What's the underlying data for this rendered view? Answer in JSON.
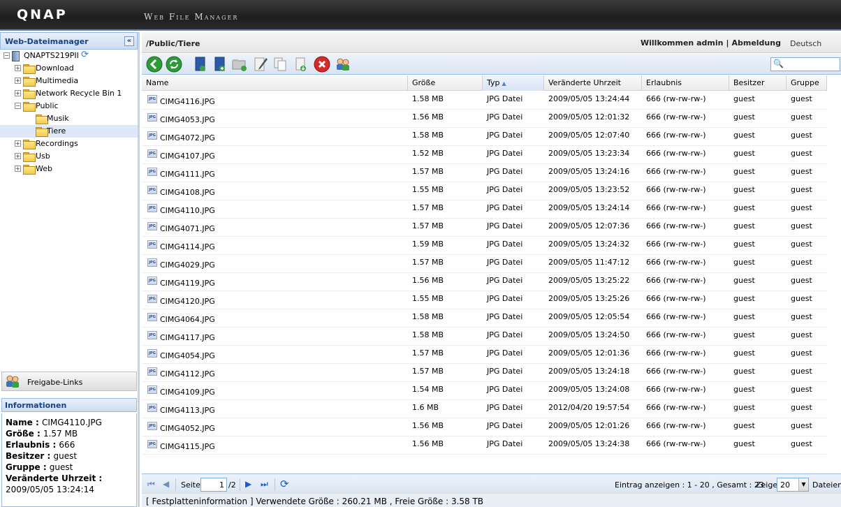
{
  "banner": {
    "logo": "QNAP",
    "product": "Web File Manager"
  },
  "sidebar": {
    "title": "Web-Dateimanager",
    "collapse_glyph": "«",
    "root": "QNAPTS219PII",
    "tree": [
      {
        "label": "Download",
        "depth": 1,
        "expanded": false
      },
      {
        "label": "Multimedia",
        "depth": 1,
        "expanded": false
      },
      {
        "label": "Network Recycle Bin 1",
        "depth": 1,
        "expanded": false
      },
      {
        "label": "Public",
        "depth": 1,
        "expanded": true
      },
      {
        "label": "Musik",
        "depth": 2,
        "expanded": false
      },
      {
        "label": "Tiere",
        "depth": 2,
        "expanded": false,
        "selected": true
      },
      {
        "label": "Recordings",
        "depth": 1,
        "expanded": false
      },
      {
        "label": "Usb",
        "depth": 1,
        "expanded": false
      },
      {
        "label": "Web",
        "depth": 1,
        "expanded": false
      }
    ],
    "share_links": "Freigabe-Links",
    "info_title": "Informationen",
    "info": {
      "name_label": "Name",
      "name": "CIMG4110.JPG",
      "size_label": "Größe",
      "size": "1.57 MB",
      "perm_label": "Erlaubnis",
      "perm": "666",
      "owner_label": "Besitzer",
      "owner": "guest",
      "group_label": "Gruppe",
      "group": "guest",
      "modified_label": "Veränderte Uhrzeit",
      "modified": "2009/05/05 13:24:14"
    }
  },
  "header": {
    "path": "/Public/Tiere",
    "welcome": "Willkommen admin",
    "separator": "|",
    "logout": "Abmeldung",
    "language": "Deutsch"
  },
  "toolbar": {
    "icons": [
      "back-icon",
      "refresh-icon",
      "new-share-icon",
      "upload-icon",
      "new-folder-icon",
      "rename-icon",
      "copy-icon",
      "download-icon",
      "delete-icon",
      "share-link-icon"
    ],
    "search_glyph": "🔍"
  },
  "grid": {
    "columns": [
      "Name",
      "Größe",
      "Typ",
      "Veränderte Uhrzeit",
      "Erlaubnis",
      "Besitzer",
      "Gruppe"
    ],
    "sort_glyph": "▲",
    "file_badge": "JPG",
    "rows": [
      [
        "CIMG4116.JPG",
        "1.58 MB",
        "JPG Datei",
        "2009/05/05 13:24:44",
        "666 (rw-rw-rw-)",
        "guest",
        "guest"
      ],
      [
        "CIMG4053.JPG",
        "1.56 MB",
        "JPG Datei",
        "2009/05/05 12:01:32",
        "666 (rw-rw-rw-)",
        "guest",
        "guest"
      ],
      [
        "CIMG4072.JPG",
        "1.58 MB",
        "JPG Datei",
        "2009/05/05 12:07:40",
        "666 (rw-rw-rw-)",
        "guest",
        "guest"
      ],
      [
        "CIMG4107.JPG",
        "1.52 MB",
        "JPG Datei",
        "2009/05/05 13:23:34",
        "666 (rw-rw-rw-)",
        "guest",
        "guest"
      ],
      [
        "CIMG4111.JPG",
        "1.57 MB",
        "JPG Datei",
        "2009/05/05 13:24:16",
        "666 (rw-rw-rw-)",
        "guest",
        "guest"
      ],
      [
        "CIMG4108.JPG",
        "1.55 MB",
        "JPG Datei",
        "2009/05/05 13:23:52",
        "666 (rw-rw-rw-)",
        "guest",
        "guest"
      ],
      [
        "CIMG4110.JPG",
        "1.57 MB",
        "JPG Datei",
        "2009/05/05 13:24:14",
        "666 (rw-rw-rw-)",
        "guest",
        "guest"
      ],
      [
        "CIMG4071.JPG",
        "1.57 MB",
        "JPG Datei",
        "2009/05/05 12:07:36",
        "666 (rw-rw-rw-)",
        "guest",
        "guest"
      ],
      [
        "CIMG4114.JPG",
        "1.59 MB",
        "JPG Datei",
        "2009/05/05 13:24:32",
        "666 (rw-rw-rw-)",
        "guest",
        "guest"
      ],
      [
        "CIMG4029.JPG",
        "1.57 MB",
        "JPG Datei",
        "2009/05/05 11:47:12",
        "666 (rw-rw-rw-)",
        "guest",
        "guest"
      ],
      [
        "CIMG4119.JPG",
        "1.56 MB",
        "JPG Datei",
        "2009/05/05 13:25:22",
        "666 (rw-rw-rw-)",
        "guest",
        "guest"
      ],
      [
        "CIMG4120.JPG",
        "1.55 MB",
        "JPG Datei",
        "2009/05/05 13:25:26",
        "666 (rw-rw-rw-)",
        "guest",
        "guest"
      ],
      [
        "CIMG4064.JPG",
        "1.58 MB",
        "JPG Datei",
        "2009/05/05 12:05:54",
        "666 (rw-rw-rw-)",
        "guest",
        "guest"
      ],
      [
        "CIMG4117.JPG",
        "1.58 MB",
        "JPG Datei",
        "2009/05/05 13:24:50",
        "666 (rw-rw-rw-)",
        "guest",
        "guest"
      ],
      [
        "CIMG4054.JPG",
        "1.57 MB",
        "JPG Datei",
        "2009/05/05 12:01:36",
        "666 (rw-rw-rw-)",
        "guest",
        "guest"
      ],
      [
        "CIMG4112.JPG",
        "1.57 MB",
        "JPG Datei",
        "2009/05/05 13:24:18",
        "666 (rw-rw-rw-)",
        "guest",
        "guest"
      ],
      [
        "CIMG4109.JPG",
        "1.54 MB",
        "JPG Datei",
        "2009/05/05 13:24:08",
        "666 (rw-rw-rw-)",
        "guest",
        "guest"
      ],
      [
        "CIMG4113.JPG",
        "1.6 MB",
        "JPG Datei",
        "2012/04/20 19:57:54",
        "666 (rw-rw-rw-)",
        "guest",
        "guest"
      ],
      [
        "CIMG4052.JPG",
        "1.56 MB",
        "JPG Datei",
        "2009/05/05 12:01:26",
        "666 (rw-rw-rw-)",
        "guest",
        "guest"
      ],
      [
        "CIMG4115.JPG",
        "1.56 MB",
        "JPG Datei",
        "2009/05/05 13:24:38",
        "666 (rw-rw-rw-)",
        "guest",
        "guest"
      ]
    ]
  },
  "pager": {
    "page_label": "Seite",
    "page_value": "1",
    "page_total": "/2",
    "first_glyph": "⏮",
    "prev_glyph": "◀",
    "next_glyph": "▶",
    "last_glyph": "⏭",
    "refresh_glyph": "⟳",
    "entries_info": "Eintrag anzeigen : 1 - 20 , Gesamt : 23",
    "show_label": "Zeige",
    "per_page": "20",
    "select_arrow": "▼",
    "files_label": "Dateien"
  },
  "status": {
    "text": "[ Festplatteninformation ] Verwendete Größe : 260.21 MB , Freie Größe : 3.58 TB"
  }
}
